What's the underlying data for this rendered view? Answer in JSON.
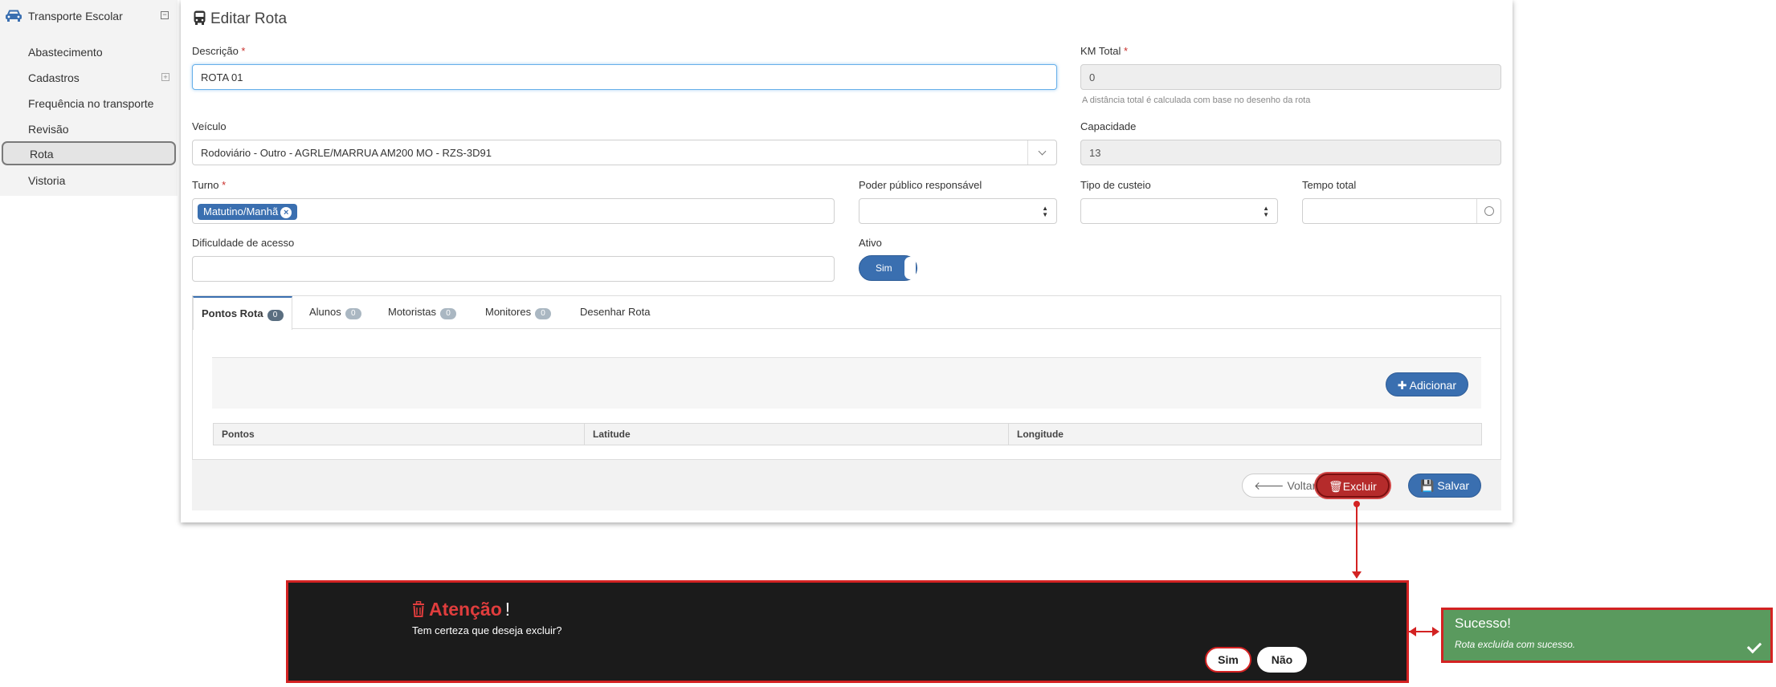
{
  "sidebar": {
    "title": "Transporte Escolar",
    "collapse_icon": "⊟",
    "items": [
      {
        "label": "Abastecimento"
      },
      {
        "label": "Cadastros",
        "expand_icon": "⊞"
      },
      {
        "label": "Frequência no transporte"
      },
      {
        "label": "Revisão"
      },
      {
        "label": "Rota"
      },
      {
        "label": "Vistoria"
      }
    ]
  },
  "page": {
    "title": "Editar Rota"
  },
  "form": {
    "required_mark": "*",
    "descricao": {
      "label": "Descrição",
      "value": "ROTA 01"
    },
    "km_total": {
      "label": "KM Total",
      "value": "0",
      "hint": "A distância total é calculada com base no desenho da rota"
    },
    "veiculo": {
      "label": "Veículo",
      "value": "Rodoviário - Outro - AGRLE/MARRUA AM200 MO - RZS-3D91"
    },
    "capacidade": {
      "label": "Capacidade",
      "value": "13"
    },
    "turno": {
      "label": "Turno",
      "tag": "Matutino/Manhã"
    },
    "poder_publico": {
      "label": "Poder público responsável",
      "value": ""
    },
    "tipo_custeio": {
      "label": "Tipo de custeio",
      "value": ""
    },
    "tempo_total": {
      "label": "Tempo total",
      "value": ""
    },
    "dificuldade": {
      "label": "Dificuldade de acesso",
      "value": ""
    },
    "ativo": {
      "label": "Ativo",
      "toggle_label": "Sim",
      "on": true
    }
  },
  "tabs": [
    {
      "label": "Pontos Rota",
      "count": "0",
      "active": true
    },
    {
      "label": "Alunos",
      "count": "0"
    },
    {
      "label": "Motoristas",
      "count": "0"
    },
    {
      "label": "Monitores",
      "count": "0"
    },
    {
      "label": "Desenhar Rota"
    }
  ],
  "grid": {
    "add_label": "Adicionar",
    "columns": [
      "Pontos",
      "Latitude",
      "Longitude"
    ]
  },
  "footer": {
    "back_label": "Voltar",
    "delete_label": "Excluir",
    "save_label": "Salvar"
  },
  "confirm": {
    "title": "Atenção",
    "title_suffix": "!",
    "message": "Tem certeza que deseja excluir?",
    "yes_label": "Sim",
    "no_label": "Não"
  },
  "toast": {
    "title": "Sucesso!",
    "message": "Rota excluída com sucesso."
  },
  "colors": {
    "primary": "#3a6fb0",
    "danger": "#b52b2b",
    "success": "#5a9a5e",
    "highlight": "#d32222"
  }
}
